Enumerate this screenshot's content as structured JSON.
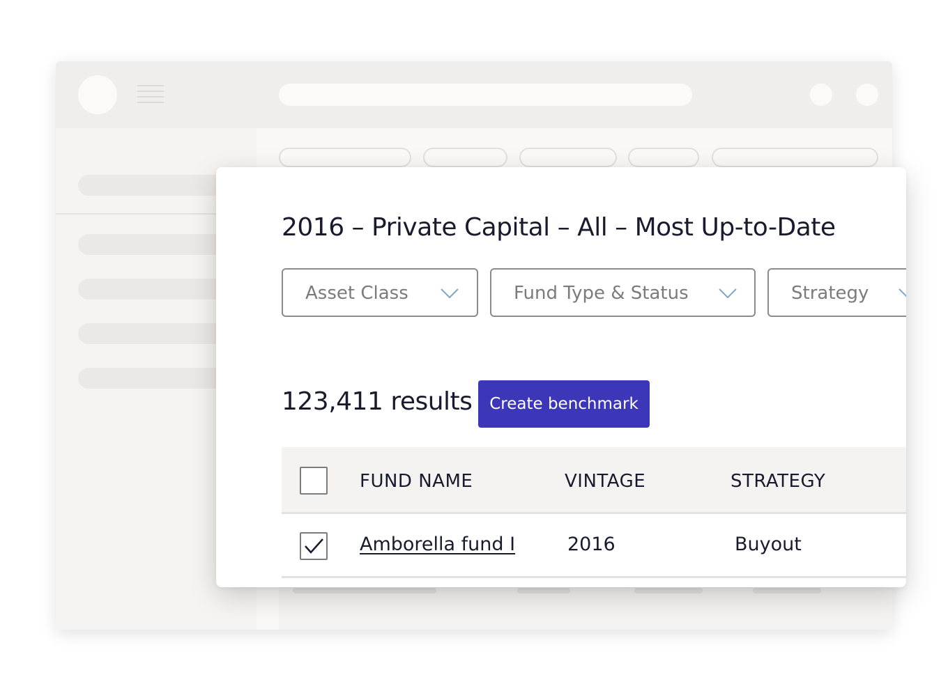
{
  "page": {
    "title": "2016 – Private Capital – All – Most Up-to-Date"
  },
  "filters": [
    {
      "label": "Asset Class",
      "icon": "chevron-down-icon"
    },
    {
      "label": "Fund Type & Status",
      "icon": "chevron-down-icon"
    },
    {
      "label": "Strategy",
      "icon": "chevron-down-icon"
    }
  ],
  "results": {
    "count_text": "123,411 results",
    "create_button_label": "Create benchmark"
  },
  "table": {
    "columns": [
      "FUND NAME",
      "VINTAGE",
      "STRATEGY"
    ],
    "rows": [
      {
        "checked": true,
        "fund_name": "Amborella fund I",
        "vintage": "2016",
        "strategy": "Buyout"
      }
    ]
  },
  "colors": {
    "accent": "#3c36b8",
    "chevron": "#7fa6c9",
    "text": "#1a1a2e"
  }
}
